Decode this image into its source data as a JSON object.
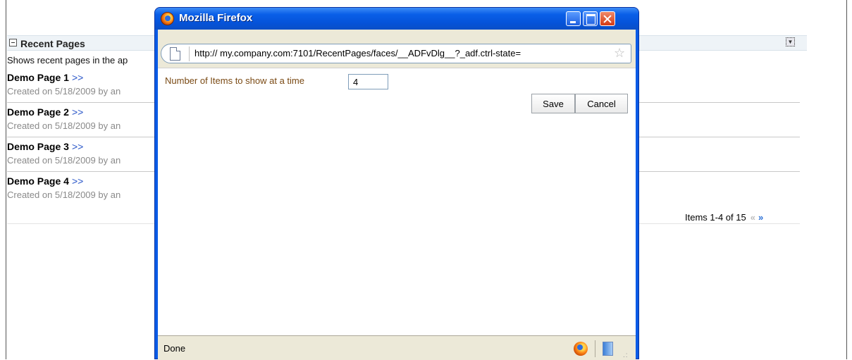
{
  "background_page": {
    "panel_title": "Recent Pages",
    "panel_description": "Shows recent pages in the ap",
    "items": [
      {
        "title": "Demo Page 1",
        "link": ">>",
        "meta": "Created on 5/18/2009 by an"
      },
      {
        "title": "Demo Page 2",
        "link": ">>",
        "meta": "Created on 5/18/2009 by an"
      },
      {
        "title": "Demo Page 3",
        "link": ">>",
        "meta": "Created on 5/18/2009 by an"
      },
      {
        "title": "Demo Page 4",
        "link": ">>",
        "meta": "Created on 5/18/2009 by an"
      }
    ],
    "pager_text": "Items 1-4 of 15",
    "pager_prev_glyph": "«",
    "pager_next_glyph": "»"
  },
  "popup": {
    "window_title": "Mozilla Firefox",
    "url": "http:// my.company.com:7101/RecentPages/faces/__ADFvDlg__?_adf.ctrl-state=",
    "field_label": "Number of Items to show at a time",
    "field_value": "4",
    "save_label": "Save",
    "cancel_label": "Cancel",
    "status_text": "Done"
  },
  "colors": {
    "titlebar": "#0a5be6",
    "field_label": "#7a4a14",
    "link_arrow": "#2855c8",
    "meta_text": "#8a8a8a"
  }
}
